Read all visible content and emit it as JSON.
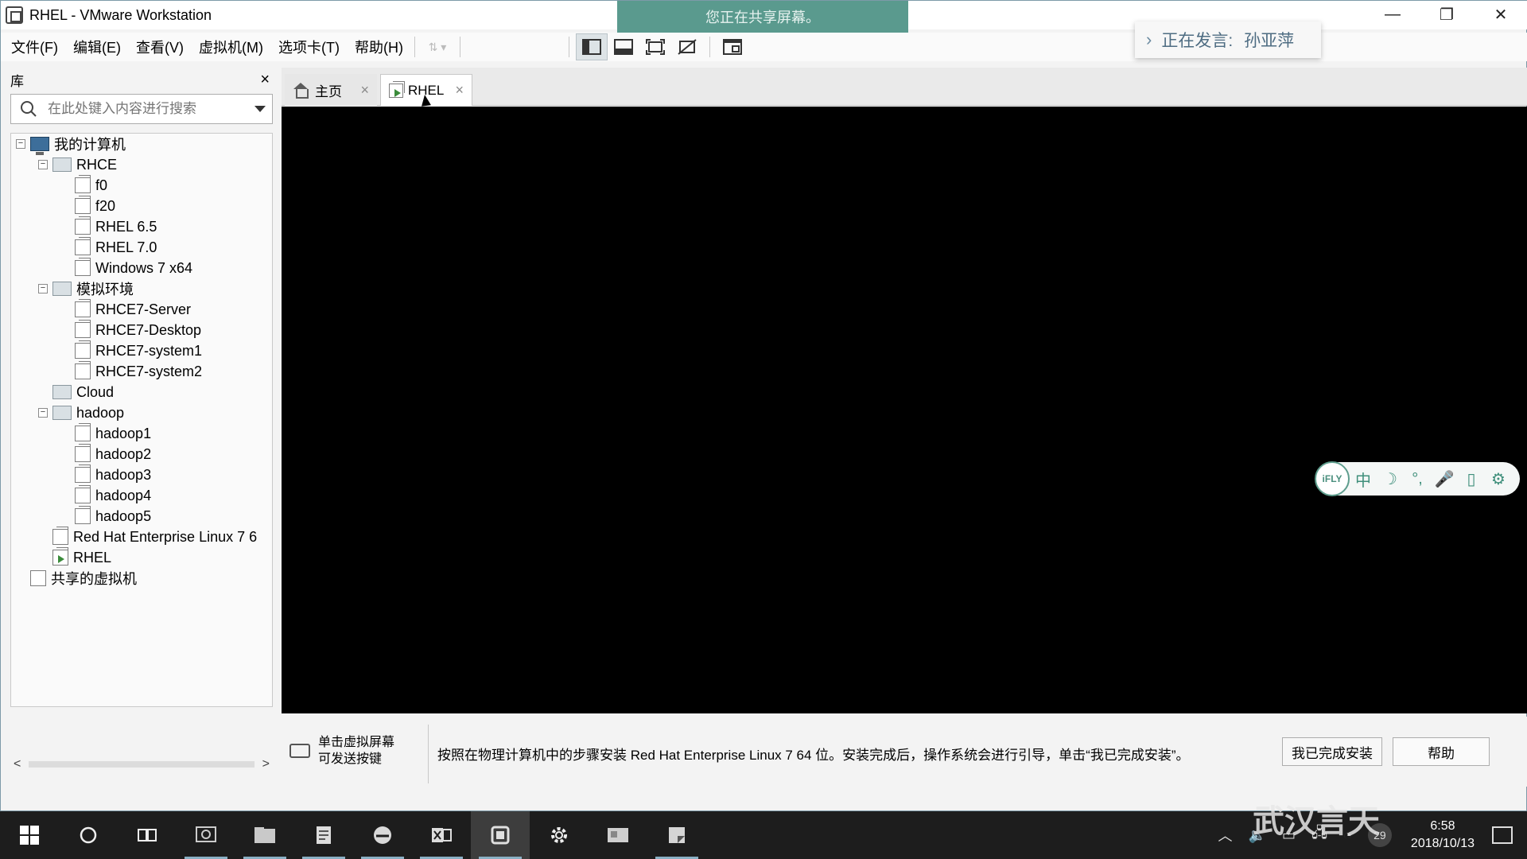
{
  "window": {
    "title": "RHEL - VMware Workstation",
    "minimize": "—",
    "restore": "❐",
    "close": "✕"
  },
  "share_banner": "您正在共享屏幕。",
  "speaker": {
    "label": "正在发言:",
    "name": "孙亚萍"
  },
  "menu": [
    "文件(F)",
    "编辑(E)",
    "查看(V)",
    "虚拟机(M)",
    "选项卡(T)",
    "帮助(H)"
  ],
  "library": {
    "title": "库",
    "close": "×",
    "search_placeholder": "在此处键入内容进行搜索",
    "tree": {
      "root": "我的计算机",
      "rhce": {
        "label": "RHCE",
        "items": [
          "f0",
          "f20",
          "RHEL 6.5",
          "RHEL 7.0",
          "Windows 7 x64"
        ]
      },
      "sim": {
        "label": "模拟环境",
        "items": [
          "RHCE7-Server",
          "RHCE7-Desktop",
          "RHCE7-system1",
          "RHCE7-system2"
        ]
      },
      "cloud": "Cloud",
      "hadoop": {
        "label": "hadoop",
        "items": [
          "hadoop1",
          "hadoop2",
          "hadoop3",
          "hadoop4",
          "hadoop5"
        ]
      },
      "rhel7": "Red Hat Enterprise Linux 7 6",
      "rhel": "RHEL",
      "shared": "共享的虚拟机"
    },
    "scroll_left": "<",
    "scroll_right": ">"
  },
  "tabs": [
    {
      "label": "主页",
      "close": "×"
    },
    {
      "label": "RHEL",
      "close": "×"
    }
  ],
  "ifly": {
    "logo": "iFLY",
    "buttons": [
      "中",
      "☽",
      "°,",
      "🎤",
      "▯",
      "⚙"
    ]
  },
  "hint": {
    "left_line1": "单击虚拟屏幕",
    "left_line2": "可发送按键",
    "message": "按照在物理计算机中的步骤安装 Red Hat Enterprise Linux 7 64 位。安装完成后，操作系统会进行引导，单击“我已完成安装”。",
    "done_button": "我已完成安装",
    "help_button": "帮助"
  },
  "taskbar": {
    "tray_badge": "29",
    "date": "2018/10/13",
    "time": "6:58"
  },
  "watermark": "武汉言天"
}
